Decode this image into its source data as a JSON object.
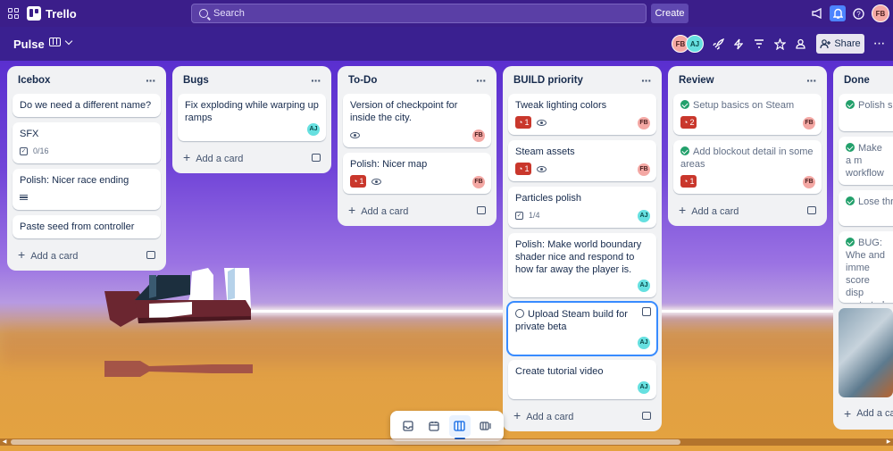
{
  "app": {
    "name": "Trello"
  },
  "topbar": {
    "search_placeholder": "Search",
    "create_label": "Create"
  },
  "user": {
    "initials": "FB"
  },
  "board": {
    "title": "Pulse",
    "share_label": "Share"
  },
  "members": [
    {
      "initials": "FB"
    },
    {
      "initials": "AJ"
    }
  ],
  "lists": [
    {
      "title": "Icebox",
      "cards": [
        {
          "title": "Do we need a different name?"
        },
        {
          "title": "SFX",
          "checklist": "0/16"
        },
        {
          "title": "Polish: Nicer race ending",
          "has_description": true
        },
        {
          "title": "Paste seed from controller"
        }
      ],
      "add_label": "Add a card"
    },
    {
      "title": "Bugs",
      "cards": [
        {
          "title": "Fix exploding while warping up ramps",
          "member": "AJ"
        }
      ],
      "add_label": "Add a card"
    },
    {
      "title": "To-Do",
      "cards": [
        {
          "title": "Version of checkpoint for inside the city.",
          "watching": true,
          "member": "FB"
        },
        {
          "title": "Polish: Nicer map",
          "notifications": "1",
          "watching": true,
          "member": "FB"
        }
      ],
      "add_label": "Add a card"
    },
    {
      "title": "BUILD priority",
      "cards": [
        {
          "title": "Tweak lighting colors",
          "notifications": "1",
          "watching": true,
          "member": "FB"
        },
        {
          "title": "Steam assets",
          "notifications": "1",
          "watching": true,
          "member": "FB"
        },
        {
          "title": "Particles polish",
          "checklist": "1/4",
          "member": "AJ"
        },
        {
          "title": "Polish: Make world boundary shader nice and respond to how far away the player is.",
          "member": "AJ"
        },
        {
          "title": "Upload Steam build for private beta",
          "member": "AJ",
          "focused": true
        },
        {
          "title": "Create tutorial video",
          "member": "AJ"
        }
      ],
      "add_label": "Add a card"
    },
    {
      "title": "Review",
      "cards": [
        {
          "title": "Setup basics on Steam",
          "notifications": "2",
          "member": "FB",
          "complete": true
        },
        {
          "title": "Add blockout detail in some areas",
          "notifications": "1",
          "member": "FB",
          "complete": true
        }
      ],
      "add_label": "Add a card"
    },
    {
      "title": "Done",
      "cards": [
        {
          "title": "Polish ship"
        },
        {
          "title": "Make a m workflow"
        },
        {
          "title": "Lose thrus"
        },
        {
          "title": "BUG: Whe and imme score disp restarted"
        }
      ],
      "add_label": "Add a car"
    }
  ],
  "colors": {
    "topbar": "#3b1e8a",
    "accent": "#0c66e4",
    "badge_red": "#c9372c",
    "complete_green": "#22a06b"
  }
}
